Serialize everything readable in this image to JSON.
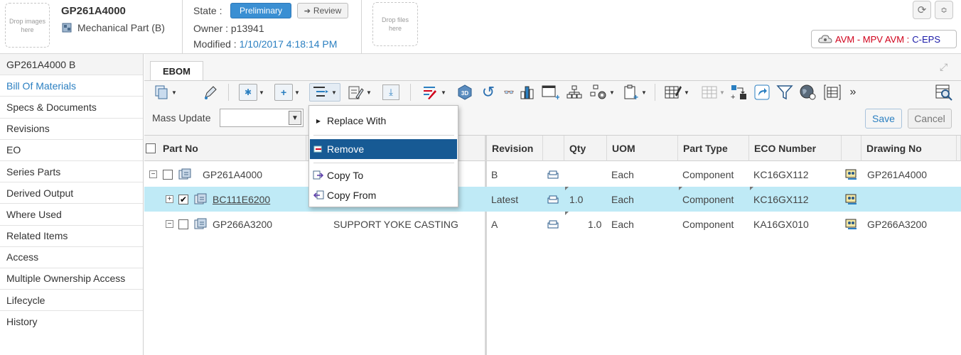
{
  "header": {
    "drop_images": "Drop images here",
    "part_number": "GP261A4000",
    "part_type": "Mechanical Part (B)",
    "state_label": "State :",
    "state_value": "Preliminary",
    "review_label": "Review",
    "owner_label": "Owner : p13941",
    "modified_label": "Modified :",
    "modified_value": "1/10/2017 4:18:14 PM",
    "drop_files": "Drop files here",
    "context_red": "AVM - MPV AVM :",
    "context_blue": "C-EPS"
  },
  "sidebar": {
    "items": [
      {
        "label": "GP261A4000 B"
      },
      {
        "label": "Bill Of Materials"
      },
      {
        "label": "Specs & Documents"
      },
      {
        "label": "Revisions"
      },
      {
        "label": "EO"
      },
      {
        "label": "Series Parts"
      },
      {
        "label": "Derived Output"
      },
      {
        "label": "Where Used"
      },
      {
        "label": "Related Items"
      },
      {
        "label": "Access"
      },
      {
        "label": "Multiple Ownership Access"
      },
      {
        "label": "Lifecycle"
      },
      {
        "label": "History"
      }
    ]
  },
  "main": {
    "tab_label": "EBOM",
    "mass_update_label": "Mass Update",
    "mass_update_value": "",
    "save_label": "Save",
    "cancel_label": "Cancel"
  },
  "context_menu": {
    "items": [
      {
        "label": "Replace With"
      },
      {
        "label": "Remove"
      },
      {
        "label": "Copy To"
      },
      {
        "label": "Copy From"
      }
    ]
  },
  "table": {
    "columns": {
      "part_no": "Part No",
      "revision": "Revision",
      "qty": "Qty",
      "uom": "UOM",
      "part_type": "Part Type",
      "eco_number": "ECO Number",
      "drawing_no": "Drawing No"
    },
    "rows": [
      {
        "part_no": "GP261A4000",
        "name": "",
        "revision": "B",
        "qty": "",
        "uom": "Each",
        "part_type": "Component",
        "eco_number": "KC16GX112",
        "drawing_no": "GP261A4000",
        "checked": false,
        "expand": "−"
      },
      {
        "part_no": "BC111E6200",
        "name": "",
        "revision": "Latest",
        "qty": "1.0",
        "uom": "Each",
        "part_type": "Component",
        "eco_number": "KC16GX112",
        "drawing_no": "",
        "checked": true,
        "expand": "+"
      },
      {
        "part_no": "GP266A3200",
        "name": "SUPPORT YOKE CASTING",
        "revision": "A",
        "qty": "1.0",
        "uom": "Each",
        "part_type": "Component",
        "eco_number": "KA16GX010",
        "drawing_no": "GP266A3200",
        "checked": false,
        "expand": "−"
      }
    ]
  }
}
